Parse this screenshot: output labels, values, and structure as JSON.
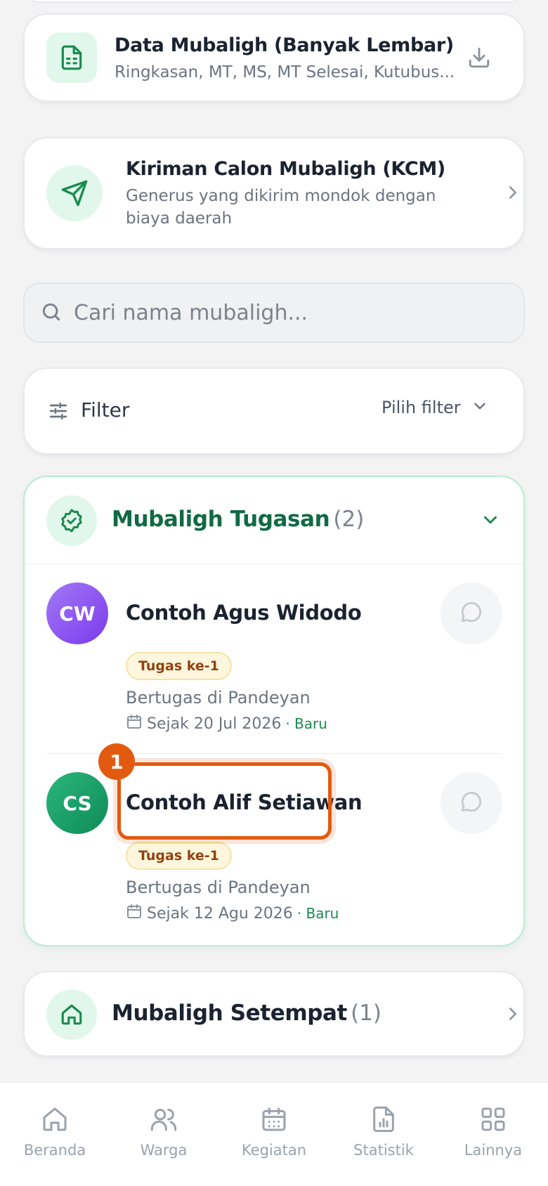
{
  "data_card": {
    "title": "Data Mubaligh (Banyak Lembar)",
    "subtitle": "Ringkasan, MT, MS, MT Selesai, Kutubus..."
  },
  "kcm_card": {
    "title": "Kiriman Calon Mubaligh (KCM)",
    "subtitle_line1": "Generus yang dikirim mondok dengan",
    "subtitle_line2": "biaya daerah"
  },
  "search": {
    "placeholder": "Cari nama mubaligh..."
  },
  "filter": {
    "label": "Filter",
    "select_label": "Pilih filter"
  },
  "tugasan": {
    "title": "Mubaligh Tugasan",
    "count": "(2)",
    "items": [
      {
        "initials": "CW",
        "name": "Contoh Agus Widodo",
        "badge": "Tugas ke-1",
        "location": "Bertugas di Pandeyan",
        "since": "Sejak 20 Jul 2026",
        "status": "· Baru"
      },
      {
        "initials": "CS",
        "name": "Contoh Alif Setiawan",
        "badge": "Tugas ke-1",
        "location": "Bertugas di Pandeyan",
        "since": "Sejak 12 Agu 2026",
        "status": "· Baru"
      }
    ]
  },
  "setempat": {
    "title": "Mubaligh Setempat",
    "count": "(1)"
  },
  "highlight_marker": "1",
  "nav": {
    "items": [
      {
        "label": "Beranda",
        "icon": "home-icon"
      },
      {
        "label": "Warga",
        "icon": "users-icon"
      },
      {
        "label": "Kegiatan",
        "icon": "calendar-icon"
      },
      {
        "label": "Statistik",
        "icon": "chart-icon"
      },
      {
        "label": "Lainnya",
        "icon": "grid-icon"
      }
    ]
  },
  "colors": {
    "accent_green": "#1a8a4f",
    "highlight_orange": "#e25a10",
    "avatar_purple": "#8b5cf6",
    "avatar_green": "#16a06a"
  }
}
